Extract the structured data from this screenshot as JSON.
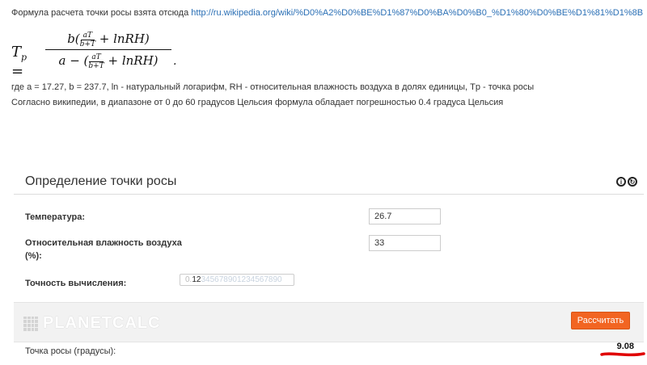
{
  "intro": {
    "text": "Формула расчета точки росы взята отсюда",
    "link": "http://ru.wikipedia.org/wiki/%D0%A2%D0%BE%D1%87%D0%BA%D0%B0_%D1%80%D0%BE%D1%81%D1%8B"
  },
  "formula": {
    "lhs": "T",
    "lhs_sub": "p",
    "num_prefix": "b(",
    "num_suffix": "+ lnRH)",
    "den_prefix": "a − (",
    "den_suffix": "+ lnRH)",
    "mini_top": "aT",
    "mini_bottom": "b+T",
    "end": "."
  },
  "description": {
    "line1": "где a = 17.27, b = 237.7, ln - натуральный логарифм, RH - относительная влажность воздуха в долях единицы, Tp - точка росы",
    "line2": "Согласно википедии, в диапазоне от 0 до 60 градусов Цельсия формула обладает погрешностью 0.4 градуса Цельсия"
  },
  "calculator": {
    "title": "Определение точки росы",
    "license_icons": [
      "cc-by-icon",
      "cc-sa-icon"
    ],
    "temperature_label": "Температура:",
    "temperature_value": "26.7",
    "humidity_label_line1": "Относительная влажность воздуха",
    "humidity_label_line2": "(%):",
    "humidity_value": "33",
    "precision_label": "Точность вычисления:",
    "precision_prefix": "0.",
    "precision_selected": "12",
    "precision_rest": "34567890123456789",
    "precision_tail": "0",
    "logo_text": "PLANETCALC",
    "calculate_button": "Рассчитать",
    "result_label": "Точка росы (градусы):",
    "result_value": "9.08"
  },
  "colors": {
    "accent": "#f26522",
    "link": "#2a6fb5",
    "annotation": "#e00000"
  }
}
